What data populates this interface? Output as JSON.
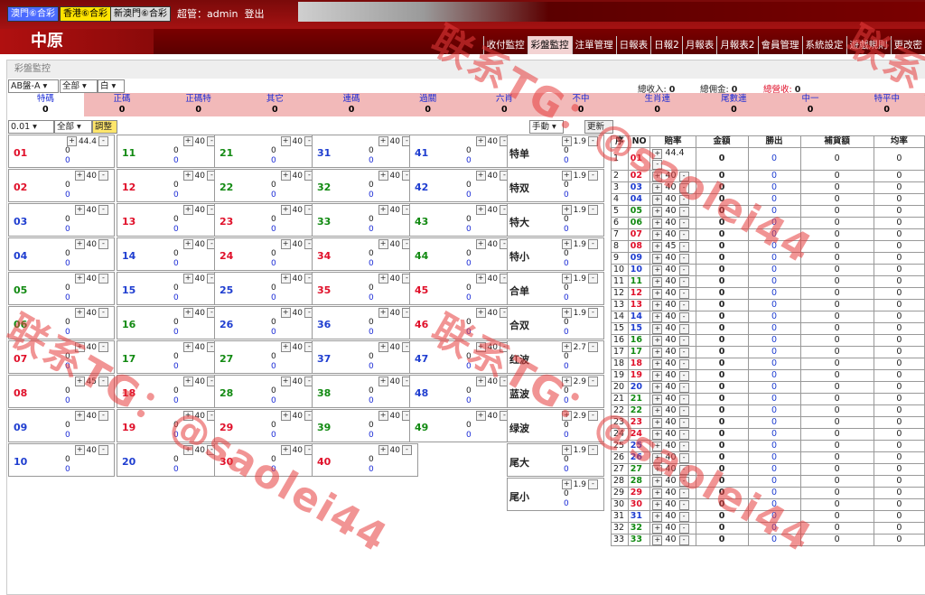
{
  "lotteries": [
    {
      "label": "澳門⑥合彩",
      "bg": "#4b6bff",
      "fg": "#fff"
    },
    {
      "label": "香港⑥合彩",
      "bg": "#ffe300",
      "fg": "#000"
    },
    {
      "label": "新澳門⑥合彩",
      "bg": "#dadada",
      "fg": "#000"
    }
  ],
  "admin_label": "超管：admin",
  "logout": "登出",
  "logo": "中原",
  "nav": [
    "收付監控",
    "彩盤監控",
    "注單管理",
    "日報表",
    "日報2",
    "月報表",
    "月報表2",
    "會員管理",
    "系統設定",
    "遊戲規則",
    "更改密"
  ],
  "panel_title": "彩盤監控",
  "selects": {
    "pan": "AB盤-A",
    "scope": "全部",
    "color": "白",
    "step": "0.01",
    "scope2": "全部",
    "mode": "手動"
  },
  "adjust_btn": "調整",
  "refresh_btn": "更新",
  "totals": {
    "income_label": "總收入:",
    "income": "0",
    "commission_label": "總佣金:",
    "commission": "0",
    "total_label": "總營收:",
    "total": "0"
  },
  "categories": [
    {
      "label": "特碼",
      "value": "0"
    },
    {
      "label": "正碼",
      "value": "0"
    },
    {
      "label": "正碼特",
      "value": "0"
    },
    {
      "label": "其它",
      "value": "0"
    },
    {
      "label": "連碼",
      "value": "0"
    },
    {
      "label": "過關",
      "value": "0"
    },
    {
      "label": "六肖",
      "value": "0"
    },
    {
      "label": "不中",
      "value": "0"
    },
    {
      "label": "生肖連",
      "value": "0"
    },
    {
      "label": "尾數連",
      "value": "0"
    },
    {
      "label": "中一",
      "value": "0"
    },
    {
      "label": "特平中",
      "value": "0"
    }
  ],
  "numbers": [
    {
      "n": "01",
      "c": "red",
      "o": "44.4"
    },
    {
      "n": "02",
      "c": "red",
      "o": "40"
    },
    {
      "n": "03",
      "c": "blue",
      "o": "40"
    },
    {
      "n": "04",
      "c": "blue",
      "o": "40"
    },
    {
      "n": "05",
      "c": "green",
      "o": "40"
    },
    {
      "n": "06",
      "c": "green",
      "o": "40"
    },
    {
      "n": "07",
      "c": "red",
      "o": "40"
    },
    {
      "n": "08",
      "c": "red",
      "o": "45"
    },
    {
      "n": "09",
      "c": "blue",
      "o": "40"
    },
    {
      "n": "10",
      "c": "blue",
      "o": "40"
    },
    {
      "n": "11",
      "c": "green",
      "o": "40"
    },
    {
      "n": "12",
      "c": "red",
      "o": "40"
    },
    {
      "n": "13",
      "c": "red",
      "o": "40"
    },
    {
      "n": "14",
      "c": "blue",
      "o": "40"
    },
    {
      "n": "15",
      "c": "blue",
      "o": "40"
    },
    {
      "n": "16",
      "c": "green",
      "o": "40"
    },
    {
      "n": "17",
      "c": "green",
      "o": "40"
    },
    {
      "n": "18",
      "c": "red",
      "o": "40"
    },
    {
      "n": "19",
      "c": "red",
      "o": "40"
    },
    {
      "n": "20",
      "c": "blue",
      "o": "40"
    },
    {
      "n": "21",
      "c": "green",
      "o": "40"
    },
    {
      "n": "22",
      "c": "green",
      "o": "40"
    },
    {
      "n": "23",
      "c": "red",
      "o": "40"
    },
    {
      "n": "24",
      "c": "red",
      "o": "40"
    },
    {
      "n": "25",
      "c": "blue",
      "o": "40"
    },
    {
      "n": "26",
      "c": "blue",
      "o": "40"
    },
    {
      "n": "27",
      "c": "green",
      "o": "40"
    },
    {
      "n": "28",
      "c": "green",
      "o": "40"
    },
    {
      "n": "29",
      "c": "red",
      "o": "40"
    },
    {
      "n": "30",
      "c": "red",
      "o": "40"
    },
    {
      "n": "31",
      "c": "blue",
      "o": "40"
    },
    {
      "n": "32",
      "c": "green",
      "o": "40"
    },
    {
      "n": "33",
      "c": "green",
      "o": "40"
    },
    {
      "n": "34",
      "c": "red",
      "o": "40"
    },
    {
      "n": "35",
      "c": "red",
      "o": "40"
    },
    {
      "n": "36",
      "c": "blue",
      "o": "40"
    },
    {
      "n": "37",
      "c": "blue",
      "o": "40"
    },
    {
      "n": "38",
      "c": "green",
      "o": "40"
    },
    {
      "n": "39",
      "c": "green",
      "o": "40"
    },
    {
      "n": "40",
      "c": "red",
      "o": "40"
    },
    {
      "n": "41",
      "c": "blue",
      "o": "40"
    },
    {
      "n": "42",
      "c": "blue",
      "o": "40"
    },
    {
      "n": "43",
      "c": "green",
      "o": "40"
    },
    {
      "n": "44",
      "c": "green",
      "o": "40"
    },
    {
      "n": "45",
      "c": "red",
      "o": "40"
    },
    {
      "n": "46",
      "c": "red",
      "o": "40"
    },
    {
      "n": "47",
      "c": "blue",
      "o": "40"
    },
    {
      "n": "48",
      "c": "blue",
      "o": "40"
    },
    {
      "n": "49",
      "c": "green",
      "o": "40"
    }
  ],
  "specials": [
    {
      "l": "特单",
      "o": "1.9"
    },
    {
      "l": "特双",
      "o": "1.9"
    },
    {
      "l": "特大",
      "o": "1.9"
    },
    {
      "l": "特小",
      "o": "1.9"
    },
    {
      "l": "合单",
      "o": "1.9"
    },
    {
      "l": "合双",
      "o": "1.9"
    },
    {
      "l": "红波",
      "o": "2.7"
    },
    {
      "l": "蓝波",
      "o": "2.9"
    },
    {
      "l": "绿波",
      "o": "2.9"
    },
    {
      "l": "尾大",
      "o": "1.9"
    },
    {
      "l": "尾小",
      "o": "1.9"
    }
  ],
  "table_headers": [
    "序",
    "NO",
    "賠率",
    "金額",
    "勝出",
    "補貨額",
    "均率"
  ],
  "table_rows": [
    {
      "i": "1",
      "n": "01",
      "c": "red",
      "o": "44.4"
    },
    {
      "i": "2",
      "n": "02",
      "c": "red",
      "o": "40"
    },
    {
      "i": "3",
      "n": "03",
      "c": "blue",
      "o": "40"
    },
    {
      "i": "4",
      "n": "04",
      "c": "blue",
      "o": "40"
    },
    {
      "i": "5",
      "n": "05",
      "c": "green",
      "o": "40"
    },
    {
      "i": "6",
      "n": "06",
      "c": "green",
      "o": "40"
    },
    {
      "i": "7",
      "n": "07",
      "c": "red",
      "o": "40"
    },
    {
      "i": "8",
      "n": "08",
      "c": "red",
      "o": "45"
    },
    {
      "i": "9",
      "n": "09",
      "c": "blue",
      "o": "40"
    },
    {
      "i": "10",
      "n": "10",
      "c": "blue",
      "o": "40"
    },
    {
      "i": "11",
      "n": "11",
      "c": "green",
      "o": "40"
    },
    {
      "i": "12",
      "n": "12",
      "c": "red",
      "o": "40"
    },
    {
      "i": "13",
      "n": "13",
      "c": "red",
      "o": "40"
    },
    {
      "i": "14",
      "n": "14",
      "c": "blue",
      "o": "40"
    },
    {
      "i": "15",
      "n": "15",
      "c": "blue",
      "o": "40"
    },
    {
      "i": "16",
      "n": "16",
      "c": "green",
      "o": "40"
    },
    {
      "i": "17",
      "n": "17",
      "c": "green",
      "o": "40"
    },
    {
      "i": "18",
      "n": "18",
      "c": "red",
      "o": "40"
    },
    {
      "i": "19",
      "n": "19",
      "c": "red",
      "o": "40"
    },
    {
      "i": "20",
      "n": "20",
      "c": "blue",
      "o": "40"
    },
    {
      "i": "21",
      "n": "21",
      "c": "green",
      "o": "40"
    },
    {
      "i": "22",
      "n": "22",
      "c": "green",
      "o": "40"
    },
    {
      "i": "23",
      "n": "23",
      "c": "red",
      "o": "40"
    },
    {
      "i": "24",
      "n": "24",
      "c": "red",
      "o": "40"
    },
    {
      "i": "25",
      "n": "25",
      "c": "blue",
      "o": "40"
    },
    {
      "i": "26",
      "n": "26",
      "c": "blue",
      "o": "40"
    },
    {
      "i": "27",
      "n": "27",
      "c": "green",
      "o": "40"
    },
    {
      "i": "28",
      "n": "28",
      "c": "green",
      "o": "40"
    },
    {
      "i": "29",
      "n": "29",
      "c": "red",
      "o": "40"
    },
    {
      "i": "30",
      "n": "30",
      "c": "red",
      "o": "40"
    },
    {
      "i": "31",
      "n": "31",
      "c": "blue",
      "o": "40"
    },
    {
      "i": "32",
      "n": "32",
      "c": "green",
      "o": "40"
    },
    {
      "i": "33",
      "n": "33",
      "c": "green",
      "o": "40"
    }
  ],
  "zero": "0",
  "watermarks": [
    "联系TG：@saolei44",
    "联系TG：@saolei44",
    "联系TG：@saolei44",
    "联系TG：@saolei44"
  ]
}
